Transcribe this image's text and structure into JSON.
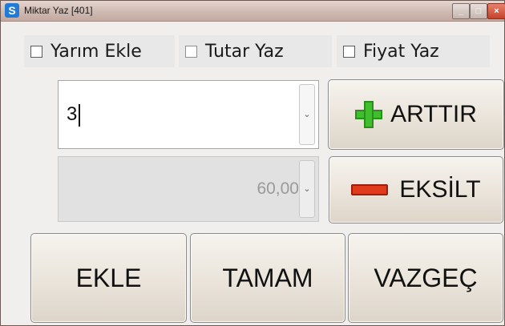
{
  "window": {
    "title": "Miktar Yaz  [401]",
    "app_icon_glyph": "S",
    "minimize_glyph": "_",
    "maximize_glyph": "□",
    "close_glyph": "×"
  },
  "options": {
    "yarim_ekle": {
      "label": "Yarım Ekle",
      "checked": false
    },
    "tutar_yaz": {
      "label": "Tutar Yaz",
      "checked": false
    },
    "fiyat_yaz": {
      "label": "Fiyat Yaz",
      "checked": false
    }
  },
  "quantity": {
    "value": "3",
    "arrow": "⌄"
  },
  "price": {
    "value": "60,00",
    "arrow": "⌄"
  },
  "buttons": {
    "arttir": "ARTTIR",
    "eksilt": "EKSİLT",
    "ekle": "EKLE",
    "tamam": "TAMAM",
    "vazgec": "VAZGEÇ"
  },
  "icons": {
    "arttir": "plus-icon",
    "eksilt": "minus-icon"
  },
  "colors": {
    "plus_green": "#3fbf2e",
    "minus_red": "#e03b1d",
    "title_bar": "#cfb9b1"
  }
}
